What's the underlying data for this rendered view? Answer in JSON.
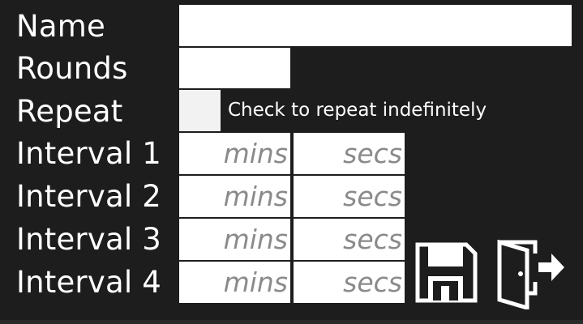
{
  "form": {
    "name": {
      "label": "Name",
      "value": "",
      "placeholder": ""
    },
    "rounds": {
      "label": "Rounds",
      "value": "",
      "placeholder": ""
    },
    "repeat": {
      "label": "Repeat",
      "checked": false,
      "hint": "Check to repeat indefinitely"
    },
    "intervals": [
      {
        "label": "Interval 1",
        "mins_placeholder": "mins",
        "secs_placeholder": "secs"
      },
      {
        "label": "Interval 2",
        "mins_placeholder": "mins",
        "secs_placeholder": "secs"
      },
      {
        "label": "Interval 3",
        "mins_placeholder": "mins",
        "secs_placeholder": "secs"
      },
      {
        "label": "Interval 4",
        "mins_placeholder": "mins",
        "secs_placeholder": "secs"
      }
    ]
  },
  "actions": {
    "save_icon": "floppy-disk-icon",
    "exit_icon": "door-exit-icon"
  },
  "colors": {
    "background": "#1d1d1d",
    "field": "#ffffff",
    "placeholder": "#8a8a8a",
    "text": "#ffffff"
  }
}
